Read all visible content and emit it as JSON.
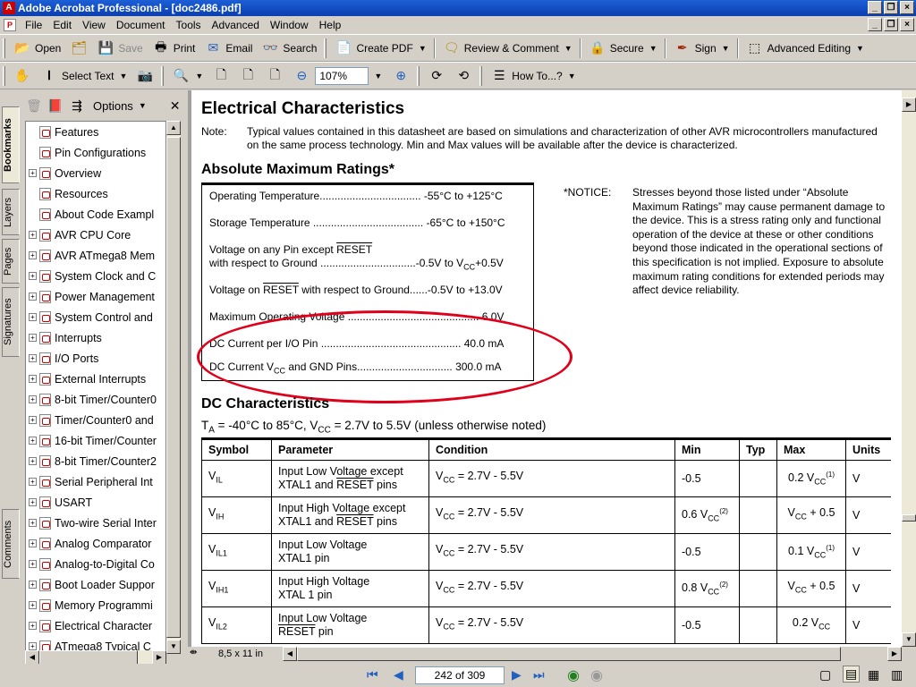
{
  "window": {
    "title": "Adobe Acrobat Professional - [doc2486.pdf]",
    "app_icon": "acrobat-icon"
  },
  "menu": [
    "File",
    "Edit",
    "View",
    "Document",
    "Tools",
    "Advanced",
    "Window",
    "Help"
  ],
  "toolbar1": {
    "open": "Open",
    "save": "Save",
    "print": "Print",
    "email": "Email",
    "search": "Search",
    "create_pdf": "Create PDF",
    "review": "Review & Comment",
    "secure": "Secure",
    "sign": "Sign",
    "advanced_editing": "Advanced Editing"
  },
  "toolbar2": {
    "select_text": "Select Text",
    "zoom": "107%",
    "howto": "How To...?"
  },
  "nav": {
    "tabs": [
      "Bookmarks",
      "Layers",
      "Pages",
      "Signatures",
      "Comments"
    ],
    "options_label": "Options",
    "bookmarks": [
      {
        "label": "Features",
        "expandable": false
      },
      {
        "label": "Pin Configurations",
        "expandable": false
      },
      {
        "label": "Overview",
        "expandable": true
      },
      {
        "label": "Resources",
        "expandable": false
      },
      {
        "label": "About Code Exampl",
        "expandable": false
      },
      {
        "label": "AVR CPU Core",
        "expandable": true
      },
      {
        "label": "AVR ATmega8 Mem",
        "expandable": true
      },
      {
        "label": "System Clock and C",
        "expandable": true
      },
      {
        "label": "Power Management",
        "expandable": true
      },
      {
        "label": "System Control and",
        "expandable": true
      },
      {
        "label": "Interrupts",
        "expandable": true
      },
      {
        "label": "I/O Ports",
        "expandable": true
      },
      {
        "label": "External Interrupts",
        "expandable": true
      },
      {
        "label": "8-bit Timer/Counter0",
        "expandable": true
      },
      {
        "label": "Timer/Counter0 and",
        "expandable": true
      },
      {
        "label": "16-bit Timer/Counter",
        "expandable": true
      },
      {
        "label": "8-bit Timer/Counter2",
        "expandable": true
      },
      {
        "label": "Serial Peripheral Int",
        "expandable": true
      },
      {
        "label": "USART",
        "expandable": true
      },
      {
        "label": "Two-wire Serial Inter",
        "expandable": true
      },
      {
        "label": "Analog Comparator",
        "expandable": true
      },
      {
        "label": "Analog-to-Digital Co",
        "expandable": true
      },
      {
        "label": "Boot Loader Suppor",
        "expandable": true
      },
      {
        "label": "Memory Programmi",
        "expandable": true
      },
      {
        "label": "Electrical Character",
        "expandable": true
      },
      {
        "label": "ATmega8 Typical C",
        "expandable": true
      }
    ]
  },
  "doc": {
    "h1": "Electrical Characteristics",
    "note_label": "Note:",
    "note_text": "Typical values contained in this datasheet are based on simulations and characterization of other AVR microcontrollers manufactured on the same process technology. Min and Max values will be available after the device is characterized.",
    "amr_title": "Absolute Maximum Ratings*",
    "amr": {
      "r1": "Operating Temperature.................................. -55°C to +125°C",
      "r2": "Storage Temperature ..................................... -65°C to +150°C",
      "r3a": "Voltage on any Pin except ",
      "r3b": "RESET",
      "r3c": "with respect to Ground ................................-0.5V to V",
      "r3d": "CC",
      "r3e": "+0.5V",
      "r4a": "Voltage on ",
      "r4b": "RESET",
      "r4c": " with respect to Ground......-0.5V to +13.0V",
      "r5": "Maximum Operating Voltage ............................................ 6.0V",
      "r6": "DC Current per I/O Pin ............................................... 40.0 mA",
      "r7a": "DC Current V",
      "r7b": "CC",
      "r7c": " and GND Pins................................ 300.0 mA"
    },
    "notice_label": "*NOTICE:",
    "notice_text": "Stresses beyond those listed under “Absolute Maximum Ratings” may cause permanent damage to the device. This is a stress rating only and functional operation of the device at these or other conditions beyond those indicated in the operational sections of this specification is not implied. Exposure to absolute maximum rating conditions for extended periods may affect device reliability.",
    "dc_title": "DC Characteristics",
    "dc_cond": {
      "a": "T",
      "b": "A",
      "c": " = -40°C to 85°C, V",
      "d": "CC",
      "e": " = 2.7V to 5.5V (unless otherwise noted)"
    },
    "dc_headers": [
      "Symbol",
      "Parameter",
      "Condition",
      "Min",
      "Typ",
      "Max",
      "Units"
    ],
    "dc_rows": [
      {
        "sym": "V",
        "sub": "IL",
        "param1": "Input Low Voltage except",
        "param2a": "XTAL1 and ",
        "param2b": "RESET",
        "param2c": " pins",
        "cond": "V",
        "condsub": "CC",
        "condtail": " = 2.7V - 5.5V",
        "min": "-0.5",
        "typ": "",
        "max": "0.2 V",
        "maxsub": "CC",
        "maxsup": "(1)",
        "units": "V"
      },
      {
        "sym": "V",
        "sub": "IH",
        "param1": "Input High Voltage except",
        "param2a": "XTAL1 and ",
        "param2b": "RESET",
        "param2c": " pins",
        "cond": "V",
        "condsub": "CC",
        "condtail": " = 2.7V - 5.5V",
        "min": "0.6 V",
        "minsub": "CC",
        "minsup": "(2)",
        "typ": "",
        "max": "V",
        "maxsub": "CC",
        "maxtail": " + 0.5",
        "units": "V"
      },
      {
        "sym": "V",
        "sub": "IL1",
        "param1": "Input Low Voltage",
        "param2a": "XTAL1 pin",
        "cond": "V",
        "condsub": "CC",
        "condtail": " = 2.7V - 5.5V",
        "min": "-0.5",
        "typ": "",
        "max": "0.1 V",
        "maxsub": "CC",
        "maxsup": "(1)",
        "units": "V"
      },
      {
        "sym": "V",
        "sub": "IH1",
        "param1": "Input High Voltage",
        "param2a": "XTAL 1 pin",
        "cond": "V",
        "condsub": "CC",
        "condtail": " = 2.7V - 5.5V",
        "min": "0.8 V",
        "minsub": "CC",
        "minsup": "(2)",
        "typ": "",
        "max": "V",
        "maxsub": "CC",
        "maxtail": " + 0.5",
        "units": "V"
      },
      {
        "sym": "V",
        "sub": "IL2",
        "param1": "Input Low Voltage",
        "param2b": "RESET",
        "param2c": " pin",
        "cond": "V",
        "condsub": "CC",
        "condtail": " = 2.7V - 5.5V",
        "min": "-0.5",
        "typ": "",
        "max": "0.2 V",
        "maxsub": "CC",
        "units": "V"
      }
    ]
  },
  "status": {
    "page_size": "8,5 x 11 in",
    "page_counter": "242 of 309"
  },
  "colors": {
    "titlebar": "#0a3fb0",
    "annotation_ellipse": "#e0001a",
    "window_bg": "#d4d0c8"
  }
}
